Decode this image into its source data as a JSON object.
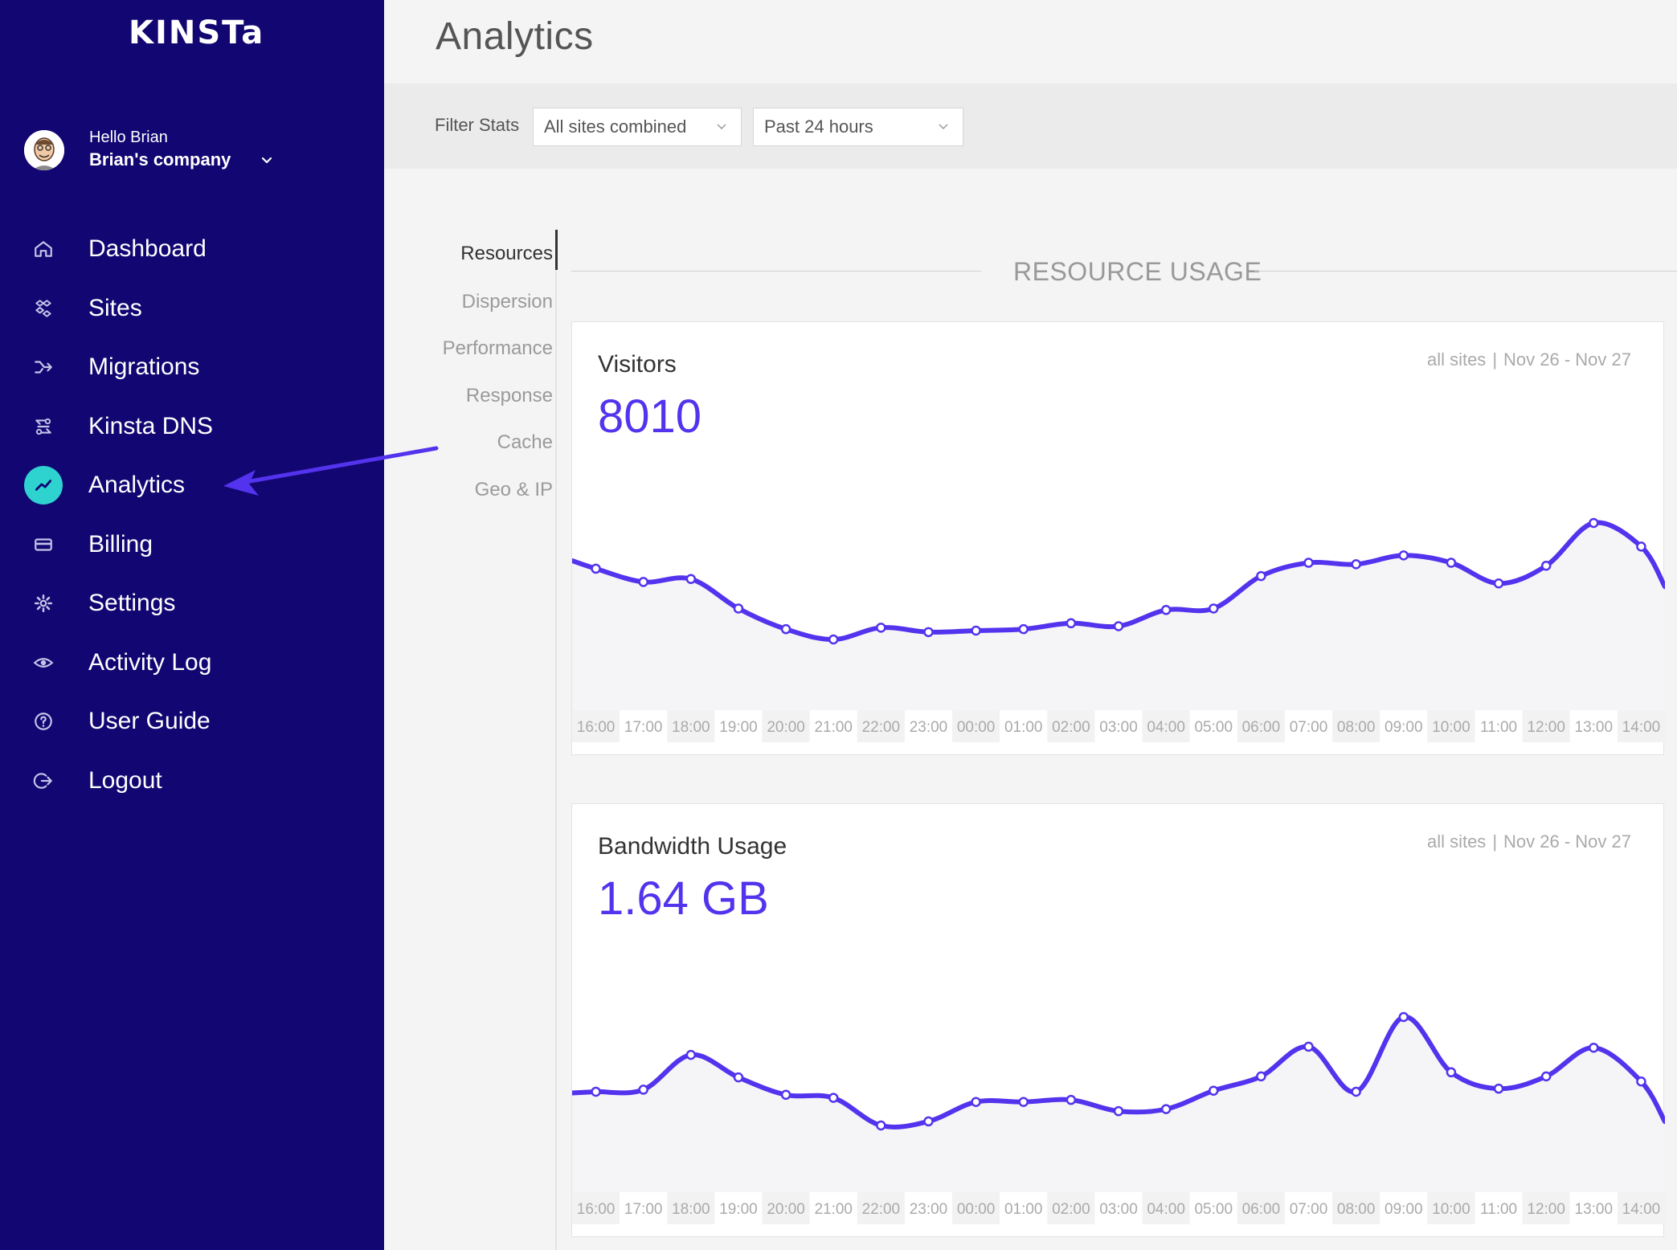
{
  "sidebar": {
    "logo": "KINSTa",
    "user": {
      "greeting": "Hello Brian",
      "company": "Brian's company"
    },
    "items": [
      {
        "label": "Dashboard",
        "icon": "home-icon"
      },
      {
        "label": "Sites",
        "icon": "sites-icon"
      },
      {
        "label": "Migrations",
        "icon": "migrations-icon"
      },
      {
        "label": "Kinsta DNS",
        "icon": "dns-icon"
      },
      {
        "label": "Analytics",
        "icon": "analytics-icon",
        "active": true
      },
      {
        "label": "Billing",
        "icon": "billing-icon"
      },
      {
        "label": "Settings",
        "icon": "gear-icon"
      },
      {
        "label": "Activity Log",
        "icon": "eye-icon"
      },
      {
        "label": "User Guide",
        "icon": "help-icon"
      },
      {
        "label": "Logout",
        "icon": "logout-icon"
      }
    ]
  },
  "main": {
    "title": "Analytics",
    "filter": {
      "label": "Filter Stats",
      "sites": "All sites combined",
      "range": "Past 24 hours"
    },
    "subnav": [
      "Resources",
      "Dispersion",
      "Performance",
      "Response",
      "Cache",
      "Geo & IP"
    ],
    "section_title": "RESOURCE USAGE"
  },
  "colors": {
    "sidebar_bg": "#120672",
    "accent": "#5333ed",
    "active_icon": "#2ed3d0"
  },
  "chart_data": [
    {
      "type": "line",
      "title": "Visitors",
      "total": "8010",
      "meta_scope": "all sites",
      "meta_range": "Nov 26 - Nov 27",
      "categories": [
        "16:00",
        "17:00",
        "18:00",
        "19:00",
        "20:00",
        "21:00",
        "22:00",
        "23:00",
        "00:00",
        "01:00",
        "02:00",
        "03:00",
        "04:00",
        "05:00",
        "06:00",
        "07:00",
        "08:00",
        "09:00",
        "10:00",
        "11:00",
        "12:00",
        "13:00",
        "14:00"
      ],
      "values": [
        325,
        316,
        318,
        298,
        284,
        277,
        285,
        282,
        283,
        284,
        288,
        286,
        297,
        298,
        320,
        329,
        328,
        334,
        329,
        315,
        327,
        356,
        340
      ]
    },
    {
      "type": "line",
      "title": "Bandwidth Usage",
      "total": "1.64 GB",
      "meta_scope": "all sites",
      "meta_range": "Nov 26 - Nov 27",
      "categories": [
        "16:00",
        "17:00",
        "18:00",
        "19:00",
        "20:00",
        "21:00",
        "22:00",
        "23:00",
        "00:00",
        "01:00",
        "02:00",
        "03:00",
        "04:00",
        "05:00",
        "06:00",
        "07:00",
        "08:00",
        "09:00",
        "10:00",
        "11:00",
        "12:00",
        "13:00",
        "14:00"
      ],
      "values": [
        65,
        67,
        101,
        79,
        62,
        59,
        32,
        36,
        55,
        55,
        57,
        46,
        48,
        66,
        80,
        109,
        65,
        138,
        84,
        68,
        80,
        108,
        75
      ]
    }
  ]
}
